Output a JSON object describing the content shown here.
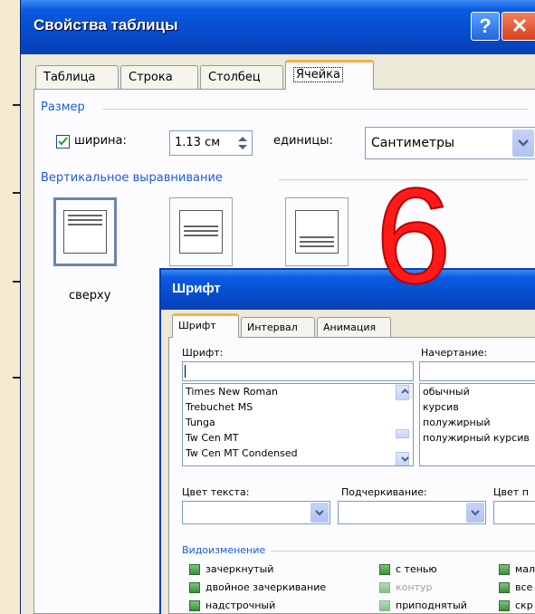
{
  "table_props": {
    "title": "Свойства таблицы",
    "help": "?",
    "close": "✕",
    "tabs": [
      "Таблица",
      "Строка",
      "Столбец",
      "Ячейка"
    ],
    "size_group": "Размер",
    "width_label": "ширина:",
    "width_value": "1.13 см",
    "units_label": "единицы:",
    "units_value": "Сантиметры",
    "valign_group": "Вертикальное выравнивание",
    "valign_top": "сверху"
  },
  "overlay_number": "6",
  "font_dialog": {
    "title": "Шрифт",
    "tabs": [
      "Шрифт",
      "Интервал",
      "Анимация"
    ],
    "font_label": "Шрифт:",
    "style_label": "Начертание:",
    "font_value": "",
    "font_list": [
      "Times New Roman",
      "Trebuchet MS",
      "Tunga",
      "Tw Cen MT",
      "Tw Cen MT Condensed"
    ],
    "style_list": [
      "обычный",
      "курсив",
      "полужирный",
      "полужирный курсив"
    ],
    "text_color_label": "Цвет текста:",
    "underline_label": "Подчеркивание:",
    "underline_color_label": "Цвет п",
    "effects_group": "Видоизменение",
    "effects": {
      "strike": "зачеркнутый",
      "double_strike": "двойное зачеркивание",
      "superscript": "надстрочный",
      "shadow": "с тенью",
      "outline": "контур",
      "emboss": "приподнятый",
      "smallcaps": "мал",
      "allcaps": "все",
      "hidden": "скр"
    }
  }
}
